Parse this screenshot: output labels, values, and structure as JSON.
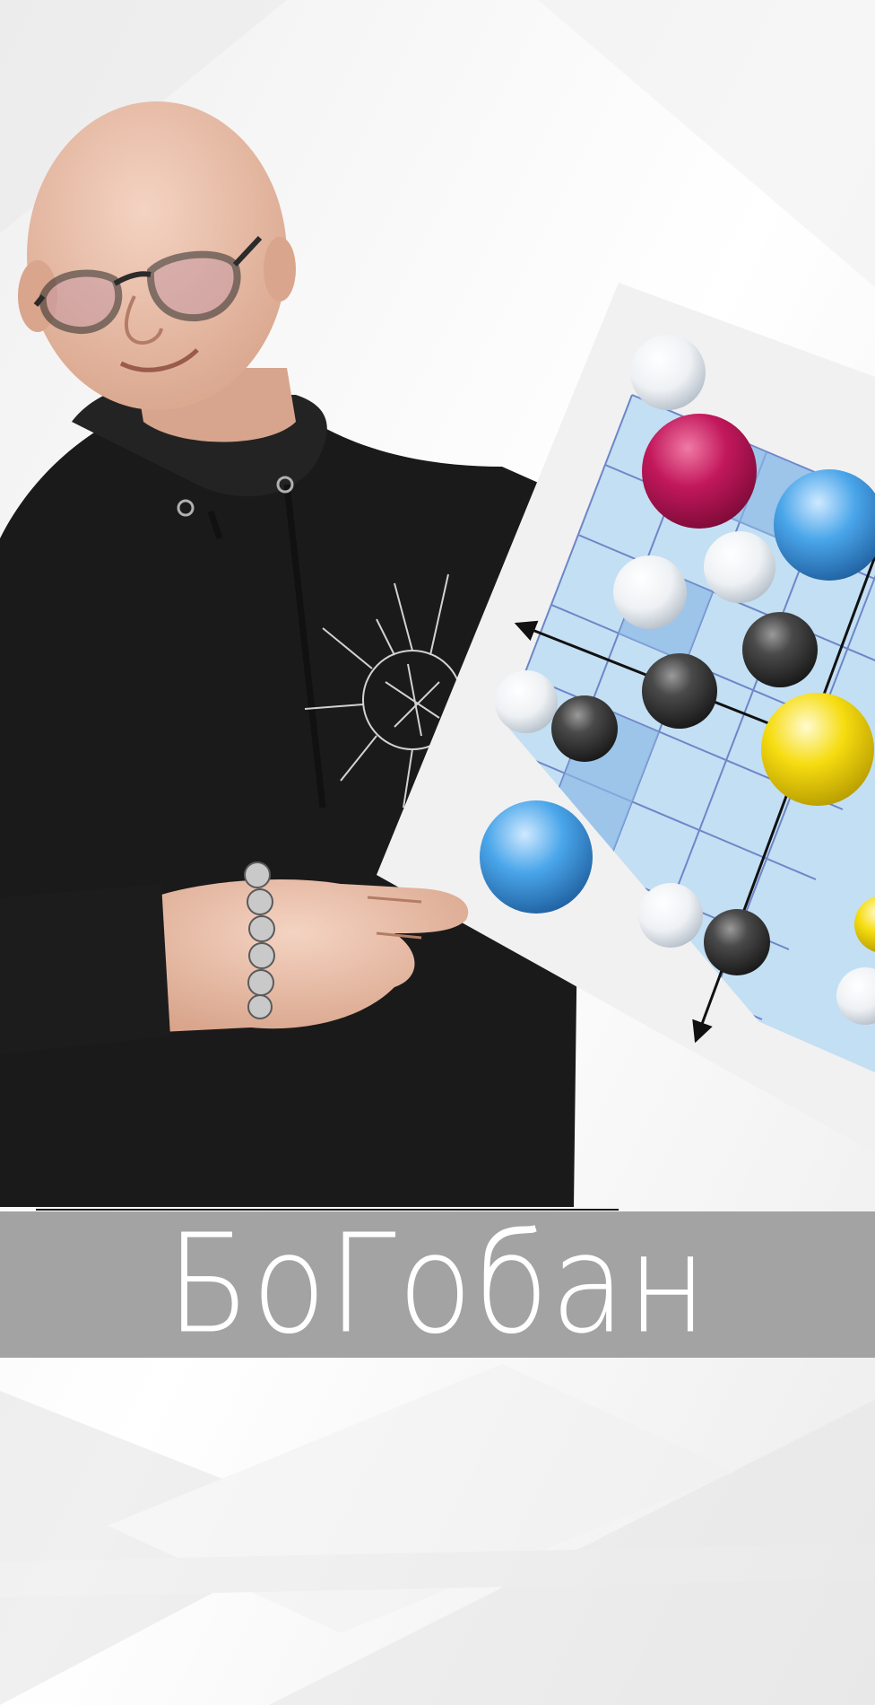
{
  "title": "БоГобан",
  "colors": {
    "background": "#fafafa",
    "title_band": "#a3a3a3",
    "title_text": "#ffffff",
    "board_cell_light": "#c3dff3",
    "board_cell_dark": "#8db9e6",
    "stone_magenta": "#c2185b",
    "stone_blue": "#3a97de",
    "stone_yellow": "#f3da00",
    "stone_black": "#3a3a3a",
    "stone_white": "#f2f4f6"
  },
  "figure": {
    "description_icon": "person-holding-board",
    "bracelet_icon": "skull-bracelet-icon"
  }
}
